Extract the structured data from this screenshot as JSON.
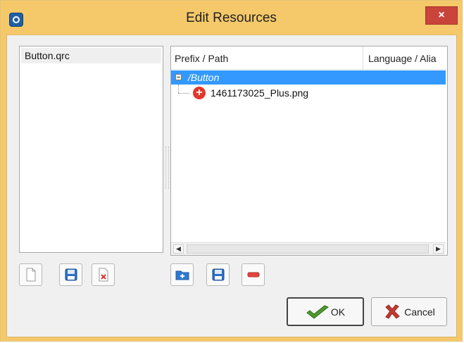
{
  "window": {
    "title": "Edit Resources",
    "close_label": "×"
  },
  "resource_files": {
    "items": [
      "Button.qrc"
    ]
  },
  "tree": {
    "columns": [
      "Prefix / Path",
      "Language / Alia"
    ],
    "rows": [
      {
        "label": "/Button",
        "kind": "prefix",
        "selected": true
      },
      {
        "label": "1461173025_Plus.png",
        "kind": "file",
        "icon": "plus-circle-icon"
      }
    ]
  },
  "left_toolbar": {
    "buttons": [
      "new-file-icon",
      "save-icon",
      "remove-file-icon"
    ]
  },
  "right_toolbar": {
    "buttons": [
      "add-prefix-icon",
      "add-file-icon",
      "remove-icon"
    ]
  },
  "dialog_buttons": {
    "ok_label": "OK",
    "cancel_label": "Cancel"
  },
  "colors": {
    "title_bar": "#f5c96a",
    "selection": "#3399ff",
    "close_button": "#c9443b"
  }
}
